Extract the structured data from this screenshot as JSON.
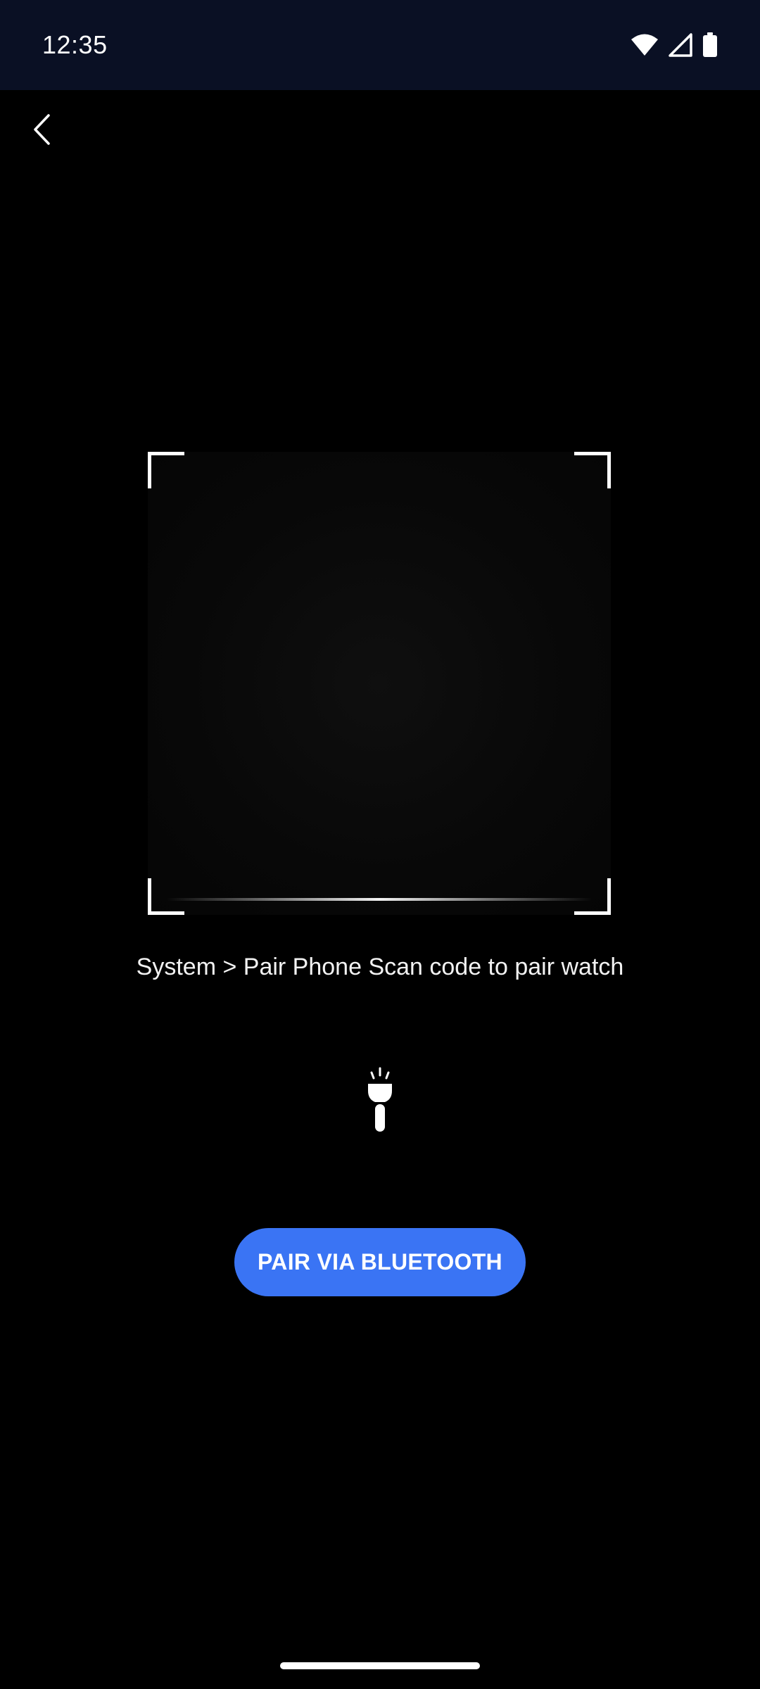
{
  "status_bar": {
    "time": "12:35",
    "icons": [
      "wifi-icon",
      "cellular-signal-icon",
      "battery-icon"
    ]
  },
  "nav": {
    "back_icon": "chevron-left-icon"
  },
  "scanner": {
    "instruction": "System > Pair Phone Scan code to pair watch",
    "flashlight_icon": "flashlight-icon"
  },
  "actions": {
    "pair_bluetooth_label": "PAIR VIA BLUETOOTH"
  },
  "colors": {
    "status_bar_bg": "#0a1024",
    "background": "#000000",
    "accent": "#3a74f4",
    "text": "#ffffff"
  }
}
